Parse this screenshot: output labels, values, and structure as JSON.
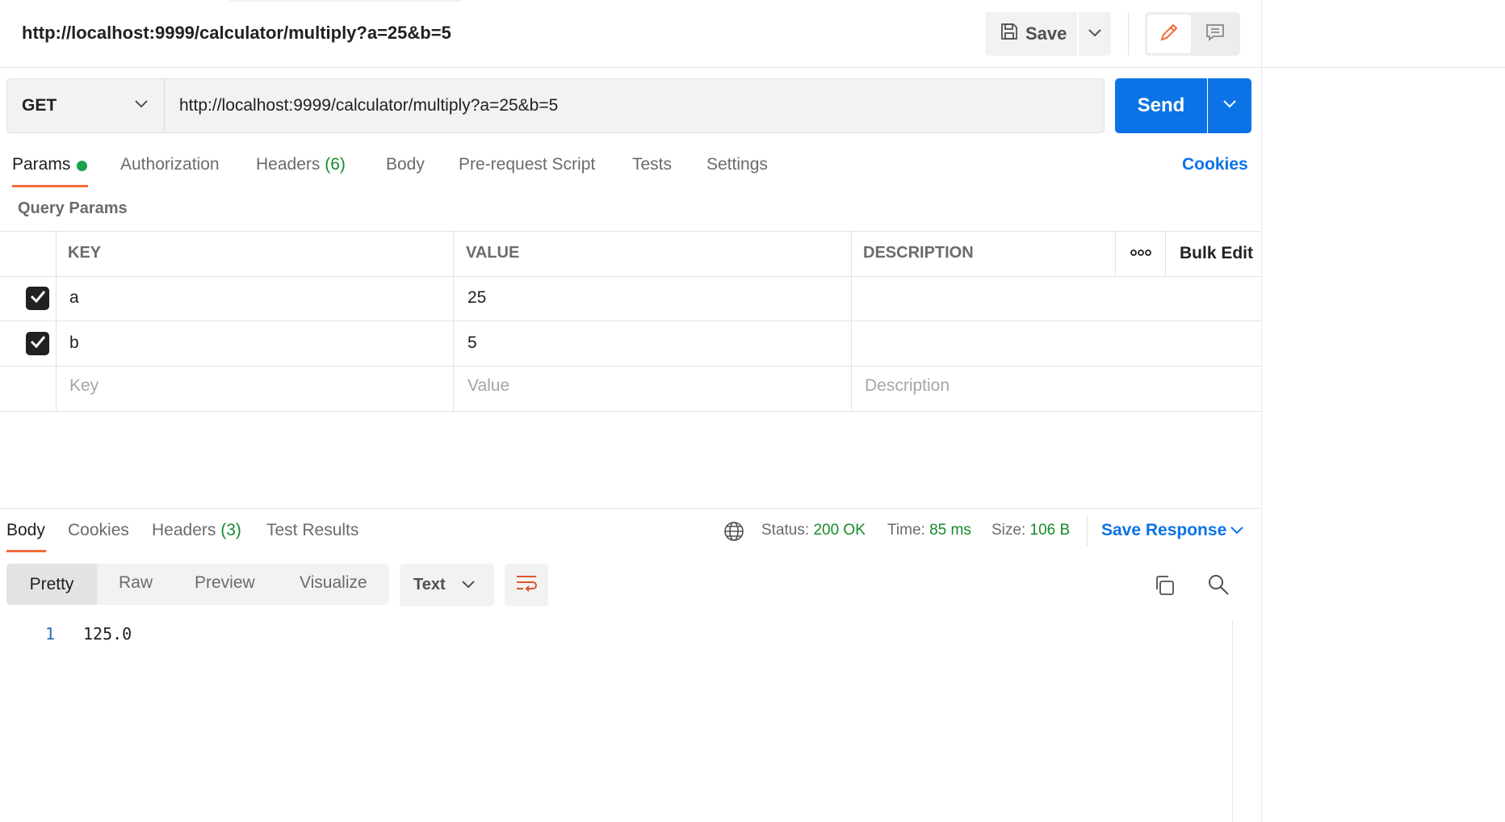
{
  "header": {
    "request_title": "http://localhost:9999/calculator/multiply?a=25&b=5",
    "save_label": "Save"
  },
  "request": {
    "method": "GET",
    "url": "http://localhost:9999/calculator/multiply?a=25&b=5",
    "send_label": "Send"
  },
  "tabs": {
    "params": "Params",
    "authorization": "Authorization",
    "headers": "Headers",
    "headers_count": "(6)",
    "body": "Body",
    "prerequest": "Pre-request Script",
    "tests": "Tests",
    "settings": "Settings",
    "cookies": "Cookies"
  },
  "query_params": {
    "title": "Query Params",
    "columns": {
      "key": "KEY",
      "value": "VALUE",
      "description": "DESCRIPTION"
    },
    "bulk_edit": "Bulk Edit",
    "rows": [
      {
        "checked": true,
        "key": "a",
        "value": "25",
        "description": ""
      },
      {
        "checked": true,
        "key": "b",
        "value": "5",
        "description": ""
      }
    ],
    "placeholders": {
      "key": "Key",
      "value": "Value",
      "description": "Description"
    }
  },
  "response": {
    "tabs": {
      "body": "Body",
      "cookies": "Cookies",
      "headers": "Headers",
      "headers_count": "(3)",
      "test_results": "Test Results"
    },
    "status_label": "Status:",
    "status_value": "200 OK",
    "time_label": "Time:",
    "time_value": "85 ms",
    "size_label": "Size:",
    "size_value": "106 B",
    "save_response": "Save Response",
    "view_modes": {
      "pretty": "Pretty",
      "raw": "Raw",
      "preview": "Preview",
      "visualize": "Visualize"
    },
    "format": "Text",
    "lines": [
      {
        "number": "1",
        "text": "125.0"
      }
    ]
  },
  "colors": {
    "accent_blue": "#0c73e6",
    "tab_underline": "#f26b3a",
    "success_green": "#158b2a"
  }
}
